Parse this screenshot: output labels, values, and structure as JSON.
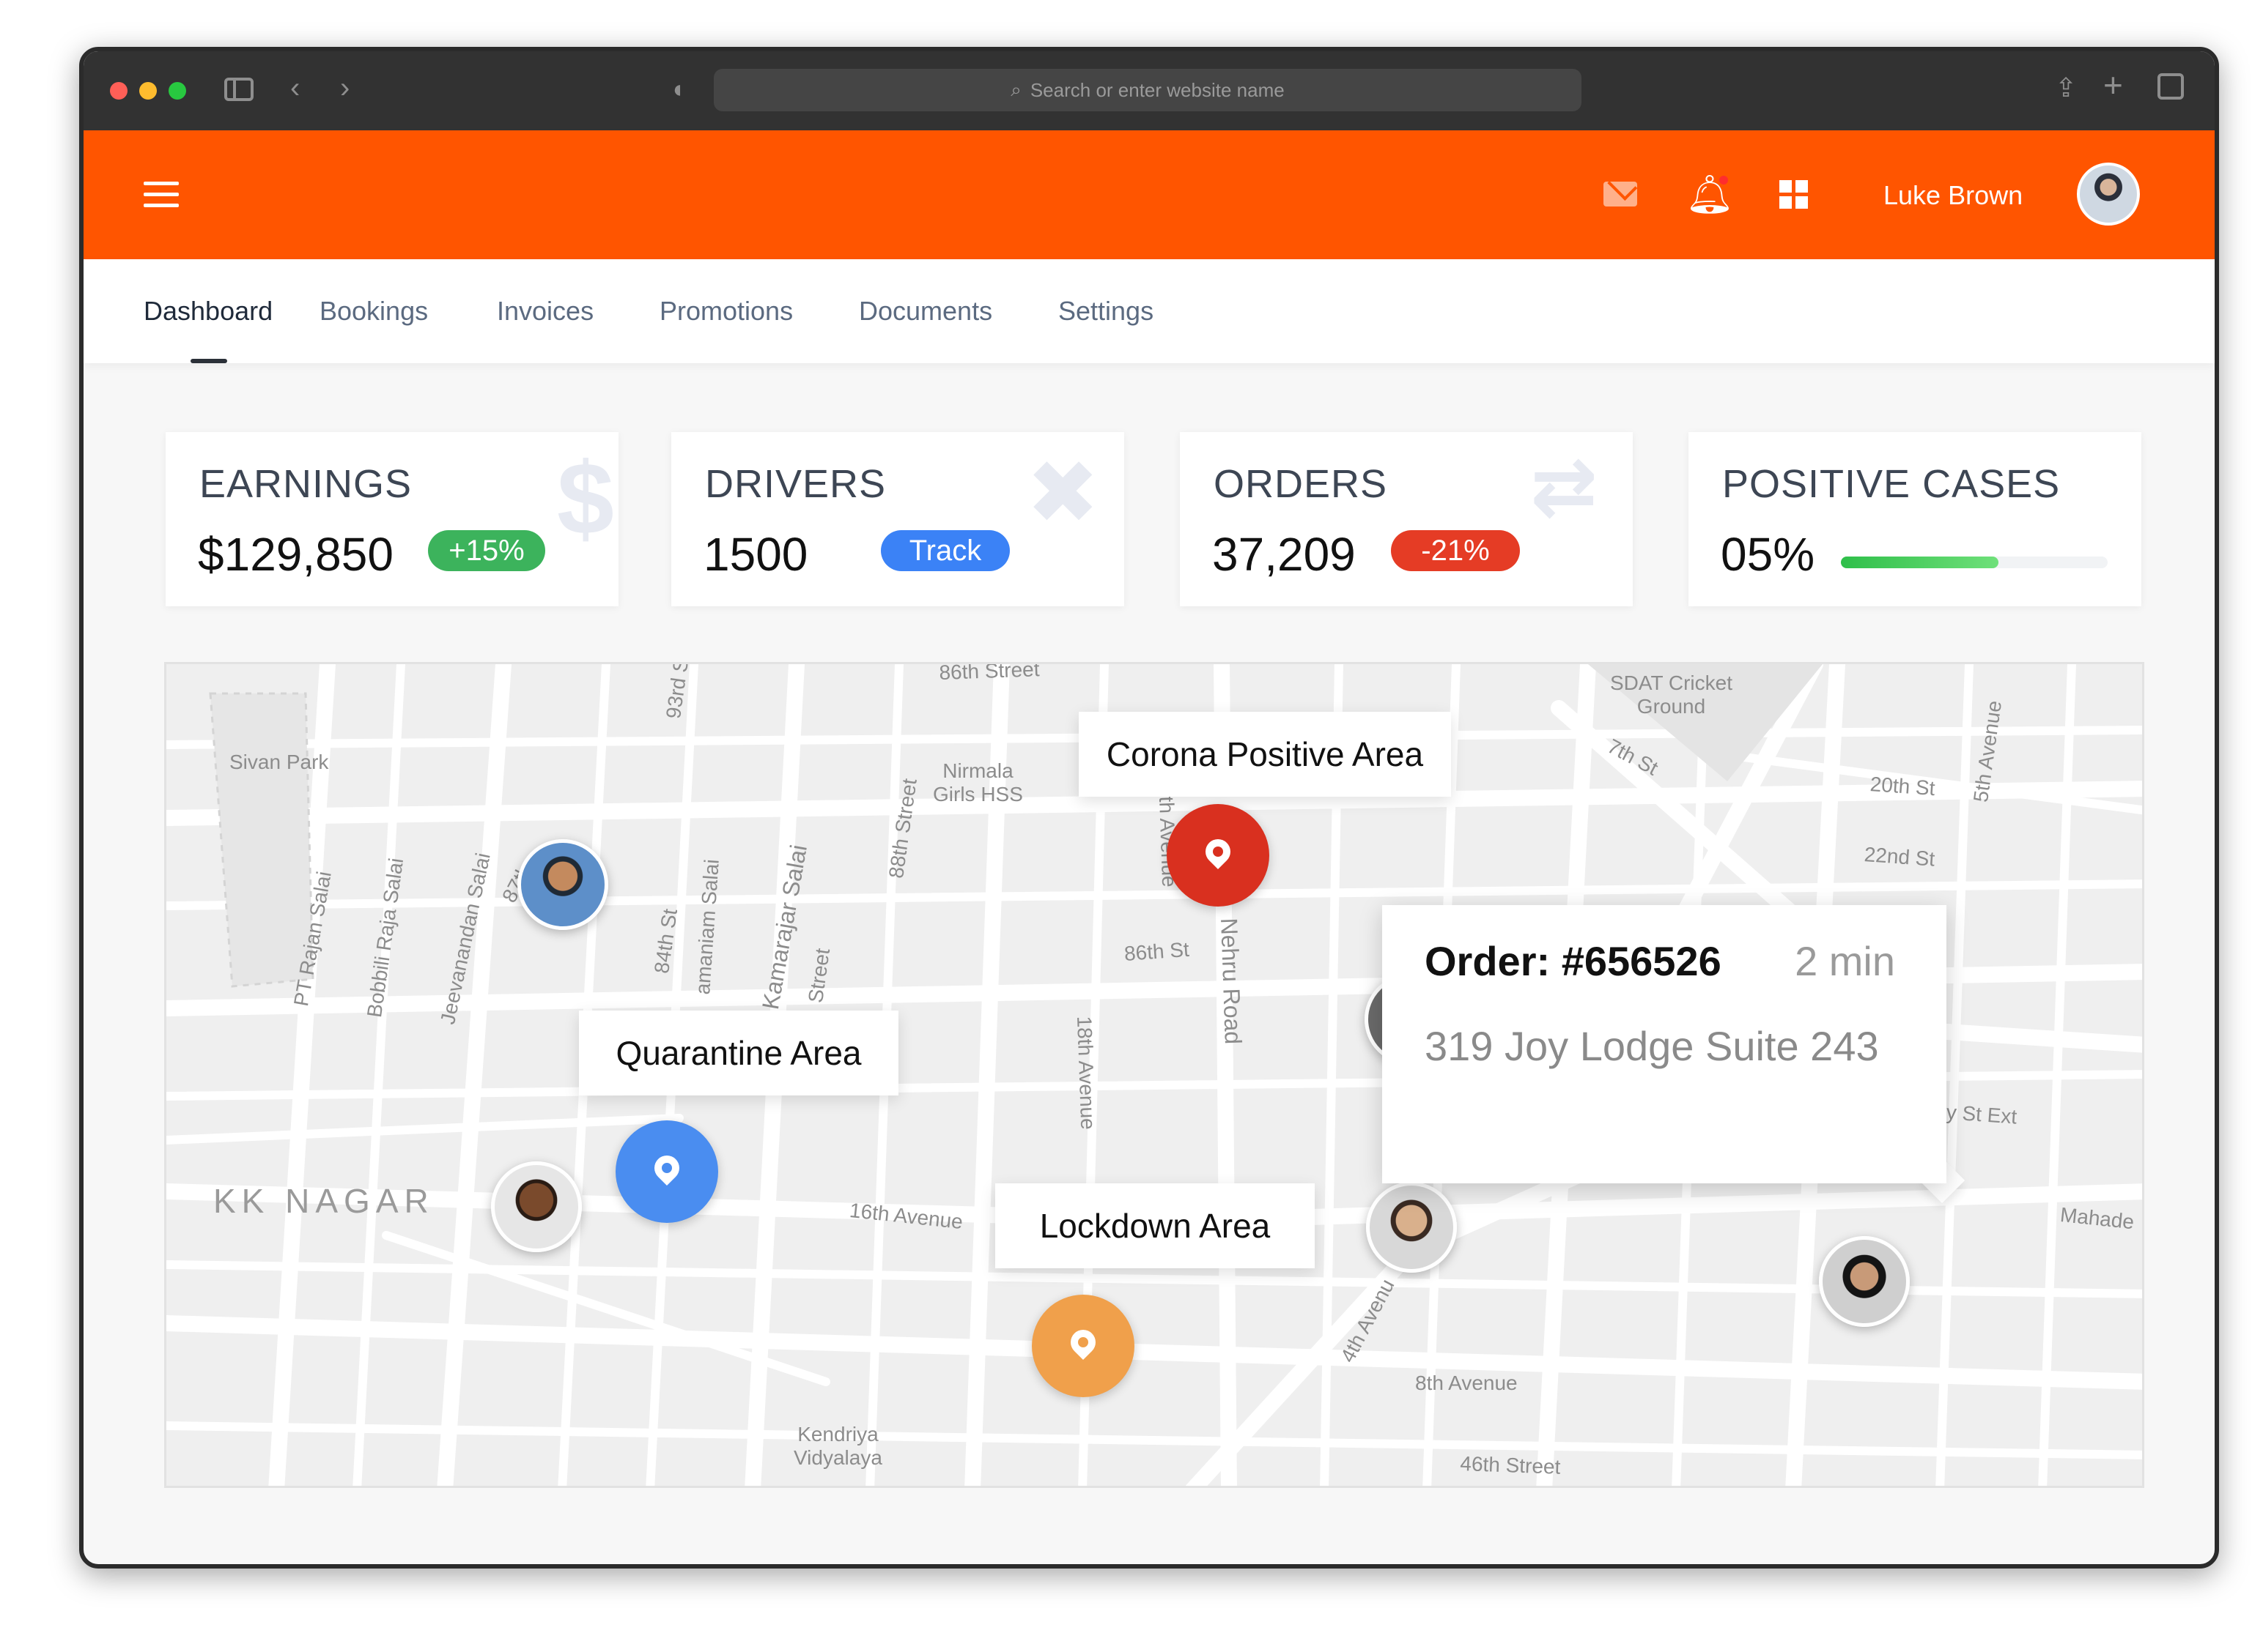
{
  "browser": {
    "url_placeholder": "Search or enter website name"
  },
  "header": {
    "username": "Luke Brown"
  },
  "nav": {
    "tabs": [
      {
        "label": "Dashboard"
      },
      {
        "label": "Bookings"
      },
      {
        "label": "Invoices"
      },
      {
        "label": "Promotions"
      },
      {
        "label": "Documents"
      },
      {
        "label": "Settings"
      }
    ]
  },
  "stats": {
    "earnings": {
      "title": "EARNINGS",
      "value": "$129,850",
      "badge": "+15%",
      "badge_color": "#3cb35c",
      "icon": "dollar-icon"
    },
    "drivers": {
      "title": "DRIVERS",
      "value": "1500",
      "badge": "Track",
      "badge_color": "#3b82f6",
      "icon": "tools-icon"
    },
    "orders": {
      "title": "ORDERS",
      "value": "37,209",
      "badge": "-21%",
      "badge_color": "#e53c25",
      "icon": "transfer-icon"
    },
    "positive_cases": {
      "title": "POSITIVE CASES",
      "value": "05%",
      "progress": 0.59
    }
  },
  "map": {
    "labels": {
      "sivan_park": "Sivan Park",
      "pt_rajan": "PT Rajan Salai",
      "bobbili": "Bobbili Raja Salai",
      "jeevanandan": "Jeevanandan Salai",
      "s87": "87th",
      "s93": "93rd S",
      "s84": "84th St",
      "amaniam": "amaniam Salai",
      "kamarajar": "Kamarajar Salai",
      "street": "Street",
      "s88": "88th Street",
      "s86_top": "86th Street",
      "nirmala": "Nirmala\nGirls HSS",
      "th_avenue": "th Avenue",
      "nehru": "Nehru Road",
      "s86": "86th St",
      "ave18": "18th Avenue",
      "ave16": "16th Avenue",
      "kk_nagar": "KK NAGAR",
      "kendriya": "Kendriya\nVidyalaya",
      "sdat": "SDAT Cricket\nGround",
      "s7": "7th St",
      "s20": "20th St",
      "s22": "22nd St",
      "ave5": "5th Avenue",
      "ystext": "y St Ext",
      "mahade": "Mahade",
      "ave4": "4th Avenu",
      "ave8": "8th Avenue",
      "s46": "46th Street"
    },
    "areas": {
      "corona": "Corona Positive Area",
      "quarantine": "Quarantine Area",
      "lockdown": "Lockdown Area"
    },
    "pin_colors": {
      "corona": "#d9301f",
      "quarantine": "#4a8df0",
      "lockdown": "#f0a04b"
    },
    "popup": {
      "title": "Order: #656526",
      "time": "2 min",
      "address": "319 Joy Lodge Suite 243"
    }
  }
}
